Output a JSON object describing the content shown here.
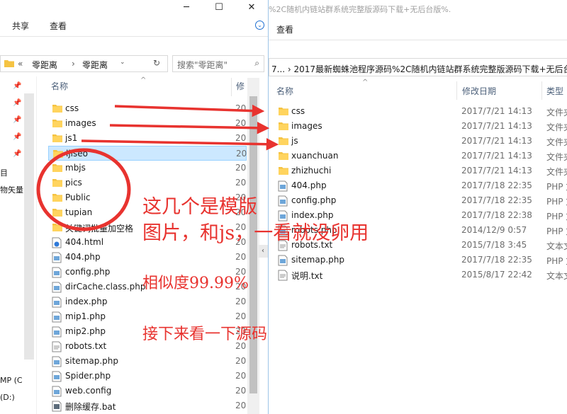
{
  "left_window": {
    "ribbon_tabs": [
      "共享",
      "查看"
    ],
    "address": {
      "prefix": "«",
      "path": [
        "零距离",
        "零距离"
      ]
    },
    "search_placeholder": "搜索\"零距离\"",
    "columns": {
      "name": "名称",
      "date": "修"
    },
    "files": [
      {
        "name": "css",
        "type": "folder",
        "date": "20"
      },
      {
        "name": "images",
        "type": "folder",
        "date": "20"
      },
      {
        "name": "js1",
        "type": "folder",
        "date": "20"
      },
      {
        "name": "ljlseo",
        "type": "folder",
        "date": "20",
        "selected": true
      },
      {
        "name": "mbjs",
        "type": "folder",
        "date": "20"
      },
      {
        "name": "pics",
        "type": "folder",
        "date": "20"
      },
      {
        "name": "Public",
        "type": "folder",
        "date": "20"
      },
      {
        "name": "tupian",
        "type": "folder",
        "date": "20"
      },
      {
        "name": "关键词批量加空格",
        "type": "folder",
        "date": "20"
      },
      {
        "name": "404.html",
        "type": "html",
        "date": "20"
      },
      {
        "name": "404.php",
        "type": "php",
        "date": "20"
      },
      {
        "name": "config.php",
        "type": "php",
        "date": "20"
      },
      {
        "name": "dirCache.class.php",
        "type": "php",
        "date": "20"
      },
      {
        "name": "index.php",
        "type": "php",
        "date": "20"
      },
      {
        "name": "mip1.php",
        "type": "php",
        "date": "20"
      },
      {
        "name": "mip2.php",
        "type": "php",
        "date": "20"
      },
      {
        "name": "robots.txt",
        "type": "txt",
        "date": "20"
      },
      {
        "name": "sitemap.php",
        "type": "php",
        "date": "20"
      },
      {
        "name": "Spider.php",
        "type": "php",
        "date": "20"
      },
      {
        "name": "web.config",
        "type": "config",
        "date": "20"
      },
      {
        "name": "删除缓存.bat",
        "type": "bat",
        "date": "20"
      }
    ],
    "nav_fragments": [
      "目",
      "物矢量",
      "MP (C",
      "(D:)"
    ]
  },
  "right_window": {
    "title_fragment": "%2C随机内链站群系统完整版源码下载+无后台版%.",
    "ribbon_tabs": [
      "查看"
    ],
    "address_text": "7...  ›  2017最新蜘蛛池程序源码%2C随机内链站群系统完整版源码下载+无后台",
    "columns": {
      "name": "名称",
      "date": "修改日期",
      "type": "类型"
    },
    "files": [
      {
        "name": "css",
        "type": "folder",
        "date": "2017/7/21 14:13",
        "kind": "文件夹"
      },
      {
        "name": "images",
        "type": "folder",
        "date": "2017/7/21 14:13",
        "kind": "文件夹"
      },
      {
        "name": "js",
        "type": "folder",
        "date": "2017/7/21 14:13",
        "kind": "文件夹"
      },
      {
        "name": "xuanchuan",
        "type": "folder",
        "date": "2017/7/21 14:13",
        "kind": "文件夹"
      },
      {
        "name": "zhizhuchi",
        "type": "folder",
        "date": "2017/7/21 14:13",
        "kind": "文件夹"
      },
      {
        "name": "404.php",
        "type": "php",
        "date": "2017/7/18 22:35",
        "kind": "PHP 文"
      },
      {
        "name": "config.php",
        "type": "php",
        "date": "2017/7/18 22:35",
        "kind": "PHP 文"
      },
      {
        "name": "index.php",
        "type": "php",
        "date": "2017/7/18 22:38",
        "kind": "PHP 文"
      },
      {
        "name": "robots.php",
        "type": "php",
        "date": "2014/12/9 0:57",
        "kind": "PHP 文"
      },
      {
        "name": "robots.txt",
        "type": "txt",
        "date": "2015/7/18 3:45",
        "kind": "文本文"
      },
      {
        "name": "sitemap.php",
        "type": "php",
        "date": "2017/7/18 22:35",
        "kind": "PHP 文"
      },
      {
        "name": "说明.txt",
        "type": "txt",
        "date": "2015/8/17 22:42",
        "kind": "文本文"
      }
    ]
  },
  "annotations": {
    "line1": "这几个是模版",
    "line2": "图片，和js，一看就没卵用",
    "similarity": "相似度99.99%",
    "next": "接下来看一下源码"
  },
  "colors": {
    "annotation_red": "#e8332f",
    "folder_yellow": "#f5c342",
    "selection_bg": "#cce8ff",
    "header_text": "#4c607a"
  }
}
